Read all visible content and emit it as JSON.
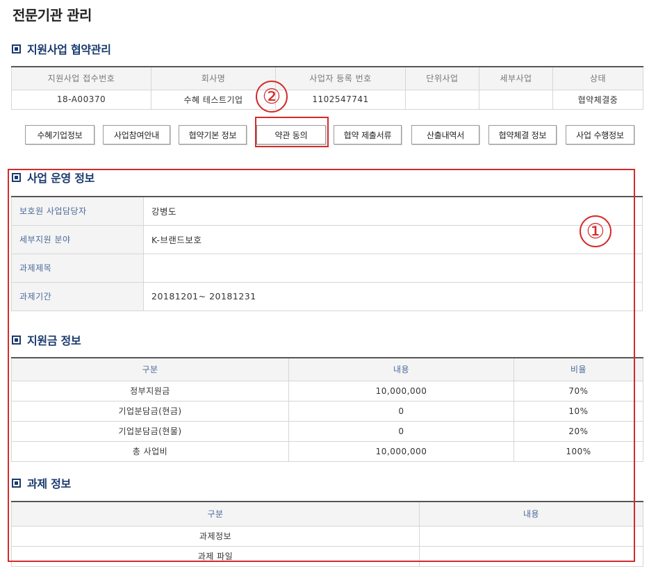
{
  "page_title": "전문기관 관리",
  "sections": {
    "agreement": "지원사업 협약관리",
    "operation": "사업 운영 정보",
    "funding": "지원금 정보",
    "task": "과제 정보"
  },
  "agreement_table": {
    "headers": [
      "지원사업 접수번호",
      "회사명",
      "사업자 등록 번호",
      "단위사업",
      "세부사업",
      "상태"
    ],
    "row": [
      "18-A00370",
      "수혜 테스트기업",
      "1102547741",
      "",
      "",
      "협약체결중"
    ]
  },
  "buttons": [
    "수혜기업정보",
    "사업참여안내",
    "협약기본 정보",
    "약관 동의",
    "협약 제출서류",
    "산출내역서",
    "협약체결 정보",
    "사업 수행정보"
  ],
  "operation_table": [
    {
      "label": "보호원 사업담당자",
      "value": "강병도"
    },
    {
      "label": "세부지원 분야",
      "value": "K-브랜드보호"
    },
    {
      "label": "과제제목",
      "value": ""
    },
    {
      "label": "과제기간",
      "value": "20181201~ 20181231"
    }
  ],
  "funding_table": {
    "headers": [
      "구분",
      "내용",
      "비율"
    ],
    "rows": [
      [
        "정부지원금",
        "10,000,000",
        "70%"
      ],
      [
        "기업분담금(현금)",
        "0",
        "10%"
      ],
      [
        "기업분담금(현물)",
        "0",
        "20%"
      ],
      [
        "총 사업비",
        "10,000,000",
        "100%"
      ]
    ]
  },
  "task_table": {
    "headers": [
      "구분",
      "내용"
    ],
    "rows": [
      [
        "과제정보",
        ""
      ],
      [
        "과제 파일",
        ""
      ]
    ]
  },
  "annotations": {
    "circle_1": "①",
    "circle_2": "②",
    "color": "#d42a2a"
  },
  "colors": {
    "section_title": "#1a3a6e",
    "header_label": "#4a6a9a"
  }
}
